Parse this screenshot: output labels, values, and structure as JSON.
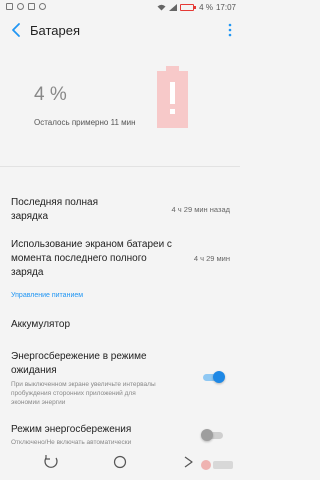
{
  "status_bar": {
    "battery_text": "4 %",
    "time": "17:07"
  },
  "header": {
    "title": "Батарея",
    "back_icon": "arrow-back-icon",
    "more_icon": "more-vert-icon"
  },
  "summary": {
    "percent": "4 %",
    "remaining": "Осталось примерно 11 мин",
    "battery_icon": "battery-alert-icon",
    "battery_color": "#f7c9c9"
  },
  "items": {
    "last_full_charge": {
      "label": "Последняя полная зарядка",
      "value": "4 ч 29 мин назад"
    },
    "screen_usage": {
      "label": "Использование экраном батареи с момента последнего полного заряда",
      "value": "4 ч 29 мин"
    }
  },
  "section": {
    "power_management": "Управление питанием"
  },
  "settings": {
    "accumulator": {
      "label": "Аккумулятор"
    },
    "standby_saving": {
      "label": "Энергосбережение в режиме ожидания",
      "description": "При выключенном экране увеличьте интервалы пробуждения сторонних приложений для экономии энергии",
      "enabled": true
    },
    "power_saving_mode": {
      "label": "Режим энергосбережения",
      "description": "Отключено/Не включать автоматически",
      "enabled": false
    }
  },
  "nav": {
    "recents_icon": "recents-icon",
    "home_icon": "home-icon",
    "back_icon": "nav-back-icon"
  },
  "colors": {
    "accent": "#2196f3",
    "toggle_on": "#1e88e5"
  }
}
